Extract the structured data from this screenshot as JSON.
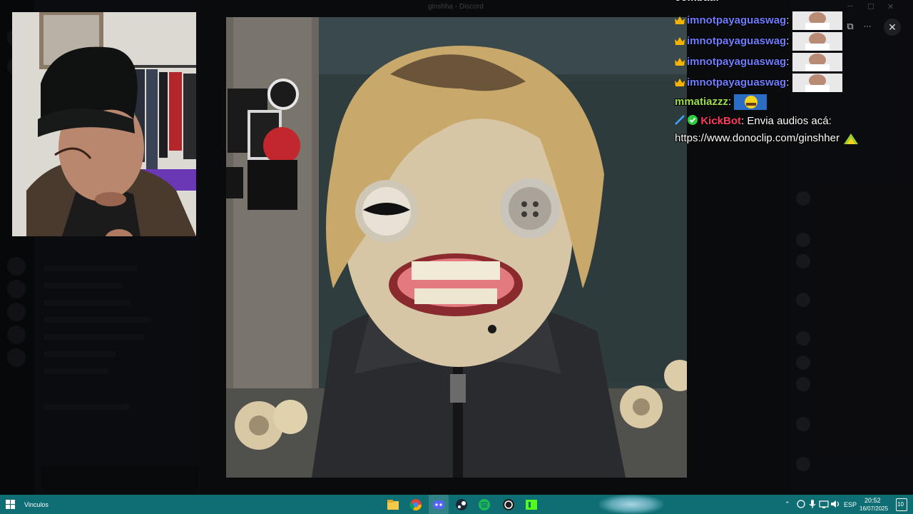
{
  "window": {
    "title": "ginshha - Discord",
    "ctl_minimize": "─",
    "ctl_maximize": "☐",
    "ctl_close": "✕"
  },
  "viewer": {
    "open_external": "⧉",
    "more": "···",
    "close": "✕"
  },
  "chat": {
    "top_partial": "combatir",
    "messages": [
      {
        "user": "imnotpayaguaswag",
        "sep": ":",
        "badge": "crown"
      },
      {
        "user": "imnotpayaguaswag",
        "sep": ":",
        "badge": "crown"
      },
      {
        "user": "imnotpayaguaswag",
        "sep": ":",
        "badge": "crown"
      },
      {
        "user": "imnotpayaguaswag",
        "sep": ":",
        "badge": "crown"
      },
      {
        "user": "mmatiazzz",
        "sep": ":"
      },
      {
        "user": "KickBot",
        "sep": ":",
        "text": "Envia audios acá:",
        "link": "https://www.donoclip.com/ginshher"
      }
    ]
  },
  "taskbar": {
    "search_label": "Vinculos",
    "language": "ESP",
    "time": "20:52",
    "date": "16/07/2025",
    "notifications": "10"
  },
  "colors": {
    "taskbar": "#0f6e74",
    "chat_user": "#6f7dff",
    "chat_mod": "#9be04a",
    "chat_bot": "#ff3b5e"
  }
}
